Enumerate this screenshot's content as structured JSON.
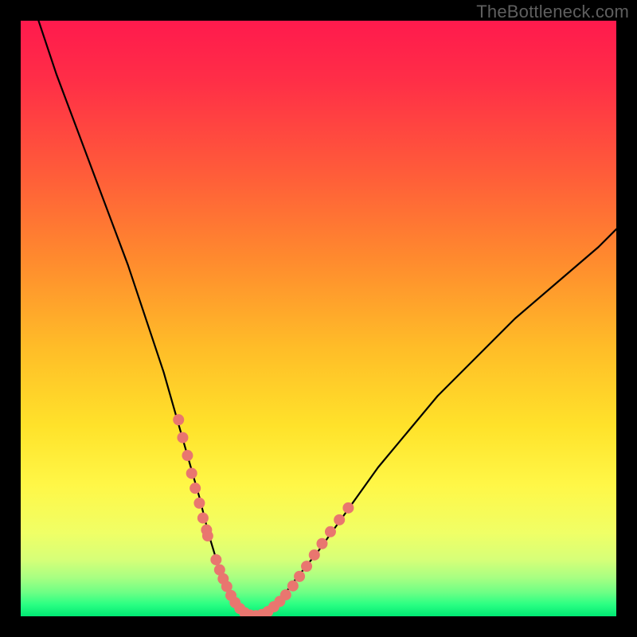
{
  "attribution": "TheBottleneck.com",
  "chart_data": {
    "type": "line",
    "title": "",
    "xlabel": "",
    "ylabel": "",
    "xlim": [
      0,
      100
    ],
    "ylim": [
      0,
      100
    ],
    "notes": "Bottleneck curve. X roughly corresponds to a component performance ratio; Y is bottleneck percentage (0 = balanced, green; 100 = severe bottleneck, red). Values estimated from pixels.",
    "series": [
      {
        "name": "bottleneck-curve",
        "x": [
          3,
          6,
          9,
          12,
          15,
          18,
          20,
          22,
          24,
          26,
          28,
          30,
          31.5,
          33,
          34.5,
          36,
          38,
          40,
          43,
          46,
          50,
          55,
          60,
          65,
          70,
          76,
          83,
          90,
          97,
          100
        ],
        "y": [
          100,
          91,
          83,
          75,
          67,
          59,
          53,
          47,
          41,
          34,
          27,
          20,
          14,
          9,
          5,
          2,
          0,
          0,
          2,
          6,
          11,
          18,
          25,
          31,
          37,
          43,
          50,
          56,
          62,
          65
        ]
      }
    ],
    "markers": {
      "name": "sample-points",
      "note": "Salmon dots clustered along the curve near the valley and low flanks.",
      "points": [
        {
          "x": 26.5,
          "y": 33
        },
        {
          "x": 27.2,
          "y": 30
        },
        {
          "x": 28.0,
          "y": 27
        },
        {
          "x": 28.7,
          "y": 24
        },
        {
          "x": 29.3,
          "y": 21.5
        },
        {
          "x": 30.0,
          "y": 19
        },
        {
          "x": 30.6,
          "y": 16.5
        },
        {
          "x": 31.2,
          "y": 14.5
        },
        {
          "x": 31.4,
          "y": 13.5
        },
        {
          "x": 32.8,
          "y": 9.5
        },
        {
          "x": 33.4,
          "y": 7.8
        },
        {
          "x": 34.0,
          "y": 6.3
        },
        {
          "x": 34.6,
          "y": 5.0
        },
        {
          "x": 35.3,
          "y": 3.5
        },
        {
          "x": 36.0,
          "y": 2.3
        },
        {
          "x": 36.8,
          "y": 1.3
        },
        {
          "x": 37.6,
          "y": 0.6
        },
        {
          "x": 38.5,
          "y": 0.2
        },
        {
          "x": 39.5,
          "y": 0.1
        },
        {
          "x": 40.5,
          "y": 0.3
        },
        {
          "x": 41.5,
          "y": 0.8
        },
        {
          "x": 42.5,
          "y": 1.6
        },
        {
          "x": 43.5,
          "y": 2.5
        },
        {
          "x": 44.5,
          "y": 3.6
        },
        {
          "x": 45.7,
          "y": 5.1
        },
        {
          "x": 46.8,
          "y": 6.7
        },
        {
          "x": 48.0,
          "y": 8.4
        },
        {
          "x": 49.3,
          "y": 10.3
        },
        {
          "x": 50.6,
          "y": 12.2
        },
        {
          "x": 52.0,
          "y": 14.2
        },
        {
          "x": 53.5,
          "y": 16.2
        },
        {
          "x": 55.0,
          "y": 18.2
        }
      ]
    },
    "gradient_stops": [
      {
        "pos": 0.0,
        "color": "#ff1a4d"
      },
      {
        "pos": 0.1,
        "color": "#ff2e47"
      },
      {
        "pos": 0.25,
        "color": "#ff5a3a"
      },
      {
        "pos": 0.4,
        "color": "#ff8a2e"
      },
      {
        "pos": 0.55,
        "color": "#ffbd28"
      },
      {
        "pos": 0.68,
        "color": "#ffe22a"
      },
      {
        "pos": 0.78,
        "color": "#fff747"
      },
      {
        "pos": 0.86,
        "color": "#f0ff66"
      },
      {
        "pos": 0.905,
        "color": "#d6ff78"
      },
      {
        "pos": 0.935,
        "color": "#a8ff82"
      },
      {
        "pos": 0.96,
        "color": "#6dff85"
      },
      {
        "pos": 0.98,
        "color": "#2bff83"
      },
      {
        "pos": 1.0,
        "color": "#00e874"
      }
    ],
    "marker_color": "#e9766f",
    "curve_color": "#000000"
  }
}
